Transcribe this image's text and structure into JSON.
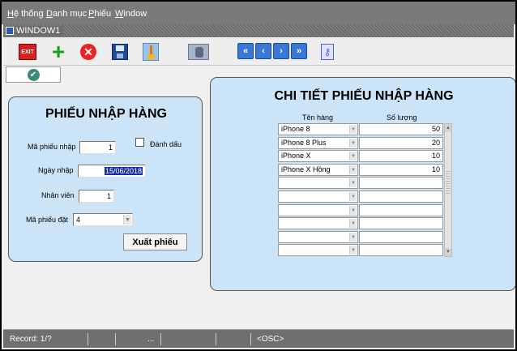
{
  "menu": {
    "items": [
      {
        "u": "H",
        "rest": "ệ thống"
      },
      {
        "u": "D",
        "rest": "anh mục"
      },
      {
        "u": "P",
        "rest": "hiếu"
      },
      {
        "u": "W",
        "rest": "indow"
      }
    ]
  },
  "window": {
    "title": "WINDOW1"
  },
  "toolbar": {
    "exit_label": "EXIT"
  },
  "left_form": {
    "title": "PHIẾU NHẬP HÀNG",
    "ma_phieu_nhap_label": "Mã phiếu nhập",
    "ma_phieu_nhap_value": "1",
    "danh_dau_label": "Đánh dấu",
    "ngay_nhap_label": "Ngày nhập",
    "ngay_nhap_value": "15/06/2018",
    "nhan_vien_label": "Nhân viên",
    "nhan_vien_value": "1",
    "ma_phieu_dat_label": "Mã phiếu đặt",
    "ma_phieu_dat_value": "4",
    "export_button": "Xuất phiếu"
  },
  "right_form": {
    "title": "CHI TIẾT PHIẾU NHẬP HÀNG",
    "col_name": "Tên hàng",
    "col_qty": "Số lượng",
    "rows": [
      {
        "name": "iPhone 8",
        "qty": "50"
      },
      {
        "name": "iPhone 8 Plus",
        "qty": "20"
      },
      {
        "name": "iPhone X",
        "qty": "10"
      },
      {
        "name": "iPhone X Hồng",
        "qty": "10"
      },
      {
        "name": "",
        "qty": ""
      },
      {
        "name": "",
        "qty": ""
      },
      {
        "name": "",
        "qty": ""
      },
      {
        "name": "",
        "qty": ""
      },
      {
        "name": "",
        "qty": ""
      },
      {
        "name": "",
        "qty": ""
      }
    ]
  },
  "status": {
    "record": "Record: 1/?",
    "dots": "...",
    "osc": "<OSC>"
  }
}
